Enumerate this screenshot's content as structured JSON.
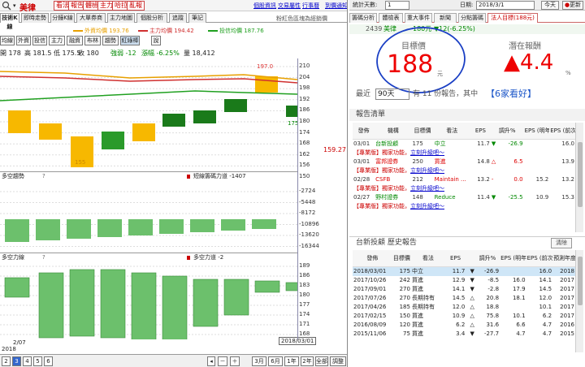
{
  "left": {
    "stock_name": "美律",
    "top_buttons": [
      "看法",
      "報告",
      "體檢",
      "主力",
      "哈拉",
      "亂報"
    ],
    "top_links": [
      "個股資訊",
      "交易屬性",
      "行事曆",
      "到價通知"
    ],
    "tabs": [
      "技術K線",
      "即時走勢",
      "分鐘K線",
      "大單券商",
      "主力地圖",
      "個股分析",
      "追蹤",
      "筆記"
    ],
    "watch_text": "粉紅色區塊為經銷價",
    "legend": [
      {
        "label": "外資均價 193.76",
        "color": "#e8a000"
      },
      {
        "label": "主力均價 194.42",
        "color": "#d03030"
      },
      {
        "label": "投信均價 187.76",
        "color": "#20a020"
      }
    ],
    "tools": [
      "均線",
      "外資",
      "投信",
      "主力",
      "融資",
      "布林",
      "趨勢",
      "紅綠棒"
    ],
    "tools_extra": "說",
    "price_info": {
      "open": "開 178",
      "high": "高 181.5",
      "low": "低 175.5",
      "close": "收 180",
      "strength": "強弱 -12",
      "pct": "漲幅 -6.25%",
      "volume": "量 18,412"
    },
    "price_axis": [
      "210",
      "204",
      "198",
      "192",
      "186",
      "180",
      "174",
      "168",
      "162",
      "156",
      "150"
    ],
    "price_tag_top": "197.0",
    "price_tag_mid": "175.00",
    "price_tag_low": "155",
    "price_current": "159.27",
    "panel2_title": "多空趨勢",
    "panel2_legend": "短線籌碼力道 -1407",
    "panel2_axis": [
      "-2724",
      "-5448",
      "-8172",
      "-10896",
      "-13620",
      "-16344"
    ],
    "panel3_title": "多空力線",
    "panel3_legend": "多空力道 -2",
    "panel3_axis": [
      "189",
      "186",
      "183",
      "180",
      "177",
      "174",
      "171",
      "168"
    ],
    "date_left": "2/07",
    "year_left": "2018",
    "date_right": "2018/03/01",
    "bottom_pages": [
      "2",
      "3",
      "4",
      "5",
      "6"
    ],
    "bottom_ranges": [
      "3月",
      "6月",
      "1年",
      "2年",
      "全部",
      "調整"
    ]
  },
  "right": {
    "data_days_label": "統計天數:",
    "data_days_value": "1",
    "date_label": "日期:",
    "date_value": "2018/3/1",
    "today_btn": "今天",
    "refresh_btn": "更新",
    "tabs": [
      "籌碼分析",
      "體檢表",
      "重大事件",
      "新聞",
      "分點籌碼",
      "法人目標(188元)"
    ],
    "stock_code": "2439",
    "stock_name": "美律",
    "stock_price": "180元",
    "stock_change": "▼12(-6.25%)",
    "target_label": "目標價",
    "target_value": "188",
    "target_unit": "元",
    "upside_label": "潛在報酬",
    "upside_value": "▲4.4",
    "upside_unit": "%",
    "recent_label": "最近",
    "recent_value": "90天",
    "recent_count": "有 11 份報告，其中",
    "bullish_text": "【6家看好】",
    "report_list_title": "報告清單",
    "list_headers": [
      "發佈",
      "機構",
      "目標價",
      "看法",
      "EPS",
      "調升%",
      "EPS (明年)",
      "EPS (前次)"
    ],
    "list_rows": [
      {
        "type": "row",
        "date": "03/01",
        "org": "台新投顧",
        "target": "175",
        "view": "中立",
        "eps": "11.7",
        "arrow": "▼",
        "chg": "-26.9",
        "eps_next": "",
        "eps_prev": "16.0",
        "color": "green"
      },
      {
        "type": "promo",
        "text": "【專業版】獨家功能，",
        "link": "立刻升級吧～"
      },
      {
        "type": "row",
        "date": "03/01",
        "org": "富邦證券",
        "target": "250",
        "view": "買進",
        "eps": "14.8",
        "arrow": "△",
        "chg": "6.5",
        "eps_next": "",
        "eps_prev": "13.9",
        "color": "red"
      },
      {
        "type": "promo",
        "text": "【專業版】獨家功能，",
        "link": "立刻升級吧～"
      },
      {
        "type": "row",
        "date": "02/28",
        "org": "CSFB",
        "target": "212",
        "view": "Maintain ...",
        "eps": "13.2",
        "arrow": "-",
        "chg": "0.0",
        "eps_next": "15.2",
        "eps_prev": "13.2",
        "color": "red"
      },
      {
        "type": "promo",
        "text": "【專業版】獨家功能，",
        "link": "立刻升級吧～"
      },
      {
        "type": "row",
        "date": "02/27",
        "org": "野村證券",
        "target": "148",
        "view": "Reduce",
        "eps": "11.4",
        "arrow": "▼",
        "chg": "-25.5",
        "eps_next": "10.9",
        "eps_prev": "15.3",
        "color": "green"
      },
      {
        "type": "promo",
        "text": "【專業版】獨家功能，",
        "link": "立刻升級吧～"
      }
    ],
    "history_title": "台新投顧 歷史報告",
    "clear_btn": "清除",
    "hist_headers": [
      "發佈",
      "目標價",
      "看法",
      "EPS",
      "",
      "調升%",
      "EPS (明年)",
      "EPS (前次)",
      "預測年度"
    ],
    "hist_rows": [
      {
        "date": "2018/03/01",
        "target": "175",
        "view": "中立",
        "eps": "11.7",
        "arrow": "▼",
        "chg": "-26.9",
        "eps_next": "",
        "eps_prev": "16.0",
        "year": "2018",
        "sel": true
      },
      {
        "date": "2017/10/26",
        "target": "242",
        "view": "買進",
        "eps": "12.9",
        "arrow": "▼",
        "chg": "-8.5",
        "eps_next": "16.0",
        "eps_prev": "14.1",
        "year": "2017"
      },
      {
        "date": "2017/09/01",
        "target": "270",
        "view": "買進",
        "eps": "14.1",
        "arrow": "▼",
        "chg": "-2.8",
        "eps_next": "17.9",
        "eps_prev": "14.5",
        "year": "2017"
      },
      {
        "date": "2017/07/26",
        "target": "270",
        "view": "長期持有",
        "eps": "14.5",
        "arrow": "△",
        "chg": "20.8",
        "eps_next": "18.1",
        "eps_prev": "12.0",
        "year": "2017"
      },
      {
        "date": "2017/04/26",
        "target": "185",
        "view": "長期持有",
        "eps": "12.0",
        "arrow": "△",
        "chg": "18.8",
        "eps_next": "",
        "eps_prev": "10.1",
        "year": "2017"
      },
      {
        "date": "2017/02/15",
        "target": "150",
        "view": "買進",
        "eps": "10.9",
        "arrow": "△",
        "chg": "75.8",
        "eps_next": "10.1",
        "eps_prev": "6.2",
        "year": "2017"
      },
      {
        "date": "2016/08/09",
        "target": "120",
        "view": "買進",
        "eps": "6.2",
        "arrow": "△",
        "chg": "31.6",
        "eps_next": "6.6",
        "eps_prev": "4.7",
        "year": "2016"
      },
      {
        "date": "2015/11/06",
        "target": "75",
        "view": "買進",
        "eps": "3.4",
        "arrow": "▼",
        "chg": "-27.7",
        "eps_next": "4.7",
        "eps_prev": "4.7",
        "year": "2015"
      }
    ]
  }
}
